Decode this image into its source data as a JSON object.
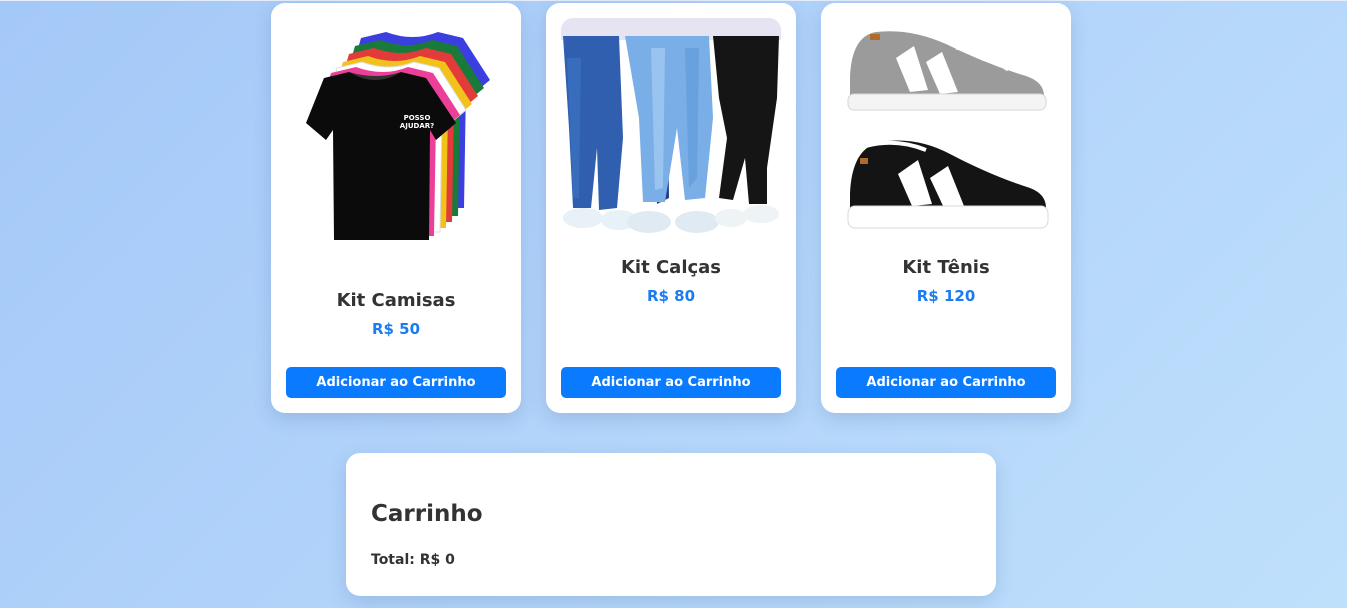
{
  "products": [
    {
      "name": "Kit Camisas",
      "price": "R$ 50",
      "button_label": "Adicionar ao Carrinho",
      "image": "tshirts-stack-image"
    },
    {
      "name": "Kit Calças",
      "price": "R$ 80",
      "button_label": "Adicionar ao Carrinho",
      "image": "jeans-image"
    },
    {
      "name": "Kit Tênis",
      "price": "R$ 120",
      "button_label": "Adicionar ao Carrinho",
      "image": "sneakers-image"
    }
  ],
  "cart": {
    "title": "Carrinho",
    "total": "Total: R$ 0"
  },
  "tshirt_print": [
    "POSSO",
    "AJUDAR?"
  ],
  "colors": {
    "accent": "#0a7bff",
    "price": "#1a7cf0",
    "text": "#333333",
    "background_start": "#a4c8f8",
    "background_end": "#bfe0fb"
  }
}
